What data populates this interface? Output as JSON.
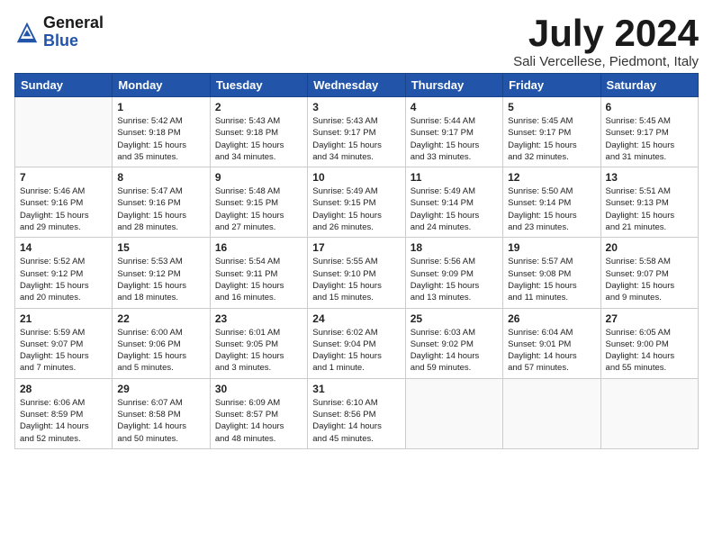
{
  "logo": {
    "general": "General",
    "blue": "Blue"
  },
  "title": "July 2024",
  "subtitle": "Sali Vercellese, Piedmont, Italy",
  "days_of_week": [
    "Sunday",
    "Monday",
    "Tuesday",
    "Wednesday",
    "Thursday",
    "Friday",
    "Saturday"
  ],
  "weeks": [
    [
      {
        "day": "",
        "info": ""
      },
      {
        "day": "1",
        "info": "Sunrise: 5:42 AM\nSunset: 9:18 PM\nDaylight: 15 hours\nand 35 minutes."
      },
      {
        "day": "2",
        "info": "Sunrise: 5:43 AM\nSunset: 9:18 PM\nDaylight: 15 hours\nand 34 minutes."
      },
      {
        "day": "3",
        "info": "Sunrise: 5:43 AM\nSunset: 9:17 PM\nDaylight: 15 hours\nand 34 minutes."
      },
      {
        "day": "4",
        "info": "Sunrise: 5:44 AM\nSunset: 9:17 PM\nDaylight: 15 hours\nand 33 minutes."
      },
      {
        "day": "5",
        "info": "Sunrise: 5:45 AM\nSunset: 9:17 PM\nDaylight: 15 hours\nand 32 minutes."
      },
      {
        "day": "6",
        "info": "Sunrise: 5:45 AM\nSunset: 9:17 PM\nDaylight: 15 hours\nand 31 minutes."
      }
    ],
    [
      {
        "day": "7",
        "info": "Sunrise: 5:46 AM\nSunset: 9:16 PM\nDaylight: 15 hours\nand 29 minutes."
      },
      {
        "day": "8",
        "info": "Sunrise: 5:47 AM\nSunset: 9:16 PM\nDaylight: 15 hours\nand 28 minutes."
      },
      {
        "day": "9",
        "info": "Sunrise: 5:48 AM\nSunset: 9:15 PM\nDaylight: 15 hours\nand 27 minutes."
      },
      {
        "day": "10",
        "info": "Sunrise: 5:49 AM\nSunset: 9:15 PM\nDaylight: 15 hours\nand 26 minutes."
      },
      {
        "day": "11",
        "info": "Sunrise: 5:49 AM\nSunset: 9:14 PM\nDaylight: 15 hours\nand 24 minutes."
      },
      {
        "day": "12",
        "info": "Sunrise: 5:50 AM\nSunset: 9:14 PM\nDaylight: 15 hours\nand 23 minutes."
      },
      {
        "day": "13",
        "info": "Sunrise: 5:51 AM\nSunset: 9:13 PM\nDaylight: 15 hours\nand 21 minutes."
      }
    ],
    [
      {
        "day": "14",
        "info": "Sunrise: 5:52 AM\nSunset: 9:12 PM\nDaylight: 15 hours\nand 20 minutes."
      },
      {
        "day": "15",
        "info": "Sunrise: 5:53 AM\nSunset: 9:12 PM\nDaylight: 15 hours\nand 18 minutes."
      },
      {
        "day": "16",
        "info": "Sunrise: 5:54 AM\nSunset: 9:11 PM\nDaylight: 15 hours\nand 16 minutes."
      },
      {
        "day": "17",
        "info": "Sunrise: 5:55 AM\nSunset: 9:10 PM\nDaylight: 15 hours\nand 15 minutes."
      },
      {
        "day": "18",
        "info": "Sunrise: 5:56 AM\nSunset: 9:09 PM\nDaylight: 15 hours\nand 13 minutes."
      },
      {
        "day": "19",
        "info": "Sunrise: 5:57 AM\nSunset: 9:08 PM\nDaylight: 15 hours\nand 11 minutes."
      },
      {
        "day": "20",
        "info": "Sunrise: 5:58 AM\nSunset: 9:07 PM\nDaylight: 15 hours\nand 9 minutes."
      }
    ],
    [
      {
        "day": "21",
        "info": "Sunrise: 5:59 AM\nSunset: 9:07 PM\nDaylight: 15 hours\nand 7 minutes."
      },
      {
        "day": "22",
        "info": "Sunrise: 6:00 AM\nSunset: 9:06 PM\nDaylight: 15 hours\nand 5 minutes."
      },
      {
        "day": "23",
        "info": "Sunrise: 6:01 AM\nSunset: 9:05 PM\nDaylight: 15 hours\nand 3 minutes."
      },
      {
        "day": "24",
        "info": "Sunrise: 6:02 AM\nSunset: 9:04 PM\nDaylight: 15 hours\nand 1 minute."
      },
      {
        "day": "25",
        "info": "Sunrise: 6:03 AM\nSunset: 9:02 PM\nDaylight: 14 hours\nand 59 minutes."
      },
      {
        "day": "26",
        "info": "Sunrise: 6:04 AM\nSunset: 9:01 PM\nDaylight: 14 hours\nand 57 minutes."
      },
      {
        "day": "27",
        "info": "Sunrise: 6:05 AM\nSunset: 9:00 PM\nDaylight: 14 hours\nand 55 minutes."
      }
    ],
    [
      {
        "day": "28",
        "info": "Sunrise: 6:06 AM\nSunset: 8:59 PM\nDaylight: 14 hours\nand 52 minutes."
      },
      {
        "day": "29",
        "info": "Sunrise: 6:07 AM\nSunset: 8:58 PM\nDaylight: 14 hours\nand 50 minutes."
      },
      {
        "day": "30",
        "info": "Sunrise: 6:09 AM\nSunset: 8:57 PM\nDaylight: 14 hours\nand 48 minutes."
      },
      {
        "day": "31",
        "info": "Sunrise: 6:10 AM\nSunset: 8:56 PM\nDaylight: 14 hours\nand 45 minutes."
      },
      {
        "day": "",
        "info": ""
      },
      {
        "day": "",
        "info": ""
      },
      {
        "day": "",
        "info": ""
      }
    ]
  ]
}
